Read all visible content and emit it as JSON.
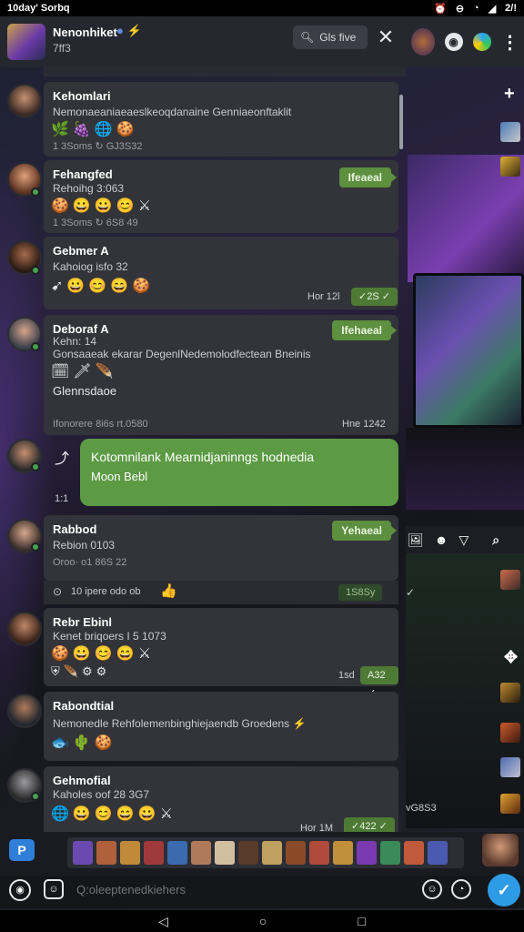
{
  "status_bar": {
    "time": "10day' Sorbq",
    "right": "2/!"
  },
  "header": {
    "title": "Nenonhiket",
    "subtitle": "7ff3",
    "search_label": "Gls five",
    "close": "✕"
  },
  "messages": [
    {
      "name": "Kehomlari",
      "line": "Nemonaeaniaeaeslkeoqdanaine Genniaeonftaklit",
      "meta": "1 3Soms ↻ GJ3S32"
    },
    {
      "name": "Fehangfed",
      "line": "Rehoihg 3:063",
      "meta": "1 3Soms ↻ 6S8 49",
      "tag": "Ifeaeal"
    },
    {
      "name": "Gebmer A",
      "line": "Kahoiog isfo 32",
      "time": "Hor 12l",
      "tick": "✓2S ✓"
    },
    {
      "name": "Deboraf A",
      "line": "Kehn: 14",
      "line2": "Gonsaaeak ekarar DegenlNedemolodfectean Bneinis",
      "extra": "Glennsdaoe",
      "tag": "Ifehaeal",
      "meta": "Ifonorere 8i6s rt.0580",
      "time": "Hne 1242"
    },
    {
      "name": "Rabbod",
      "line": "Rebion 0103",
      "meta": "Oroo· o1 86S 22",
      "tag": "Yehaeal"
    },
    {
      "name": "Rebr Ebinl",
      "line": "Kenet briqoers I 5 1073",
      "time": "1sd",
      "tick": "A32 ✓"
    },
    {
      "name": "Rabondtial",
      "line": "Nemonedle Rehfolemenbinghiejaendb Groedens ⚡"
    },
    {
      "name": "Gehmofial",
      "line": "Kaholes oof 28 3G7",
      "time": "Hor 1M",
      "tick": "✓422 ✓"
    }
  ],
  "bubble": {
    "text": "Kotomnilank Mearnidjaninngs hodnedia",
    "text2": "Moon Bebl",
    "prefix": "1:1"
  },
  "reaction_row": {
    "text": "10 ipere odo ob",
    "tag": "1S8Sy"
  },
  "right_panel": {
    "label": "vG8S3"
  },
  "input": {
    "placeholder": "Q:oleeptenedkiehers"
  },
  "colors": {
    "accent_green": "#5c8f3e",
    "send_blue": "#2e9be6",
    "panel_bg": "#323439"
  },
  "icons": [
    "search-icon",
    "close-icon",
    "camera-icon",
    "emoji-icon",
    "attach-icon",
    "mic-icon",
    "send-icon",
    "plus-icon",
    "menu-icon"
  ]
}
